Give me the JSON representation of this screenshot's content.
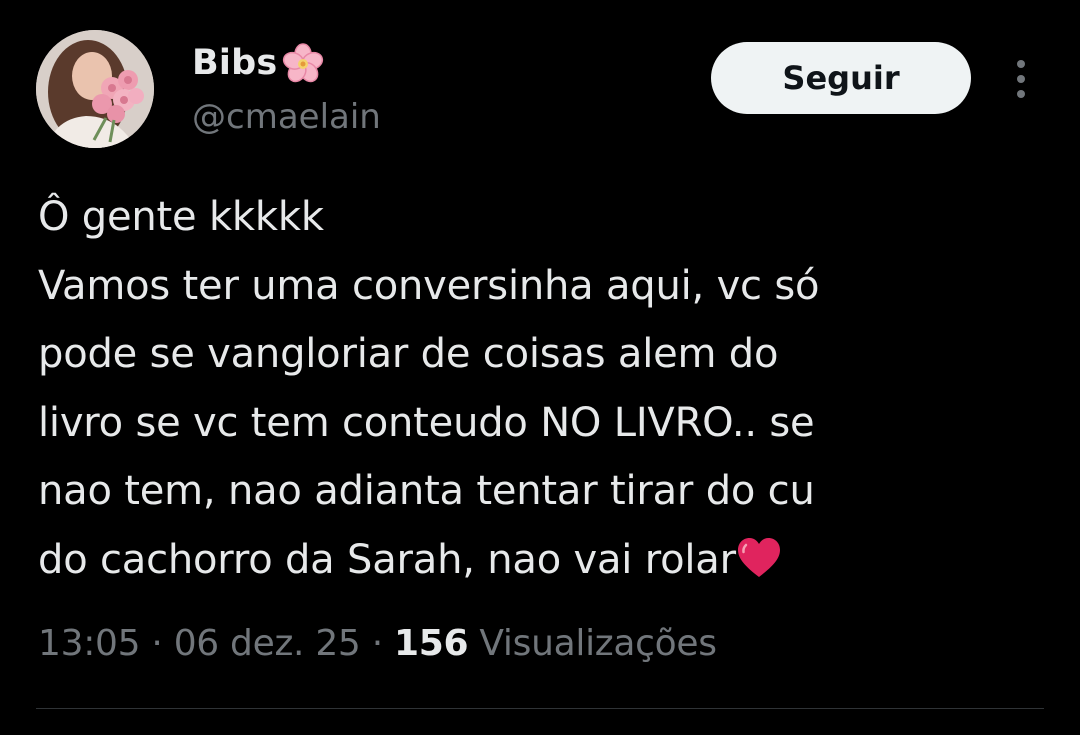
{
  "user": {
    "display_name": "Bibs",
    "name_emoji_icon": "cherry-blossom-icon",
    "handle": "@cmaelain"
  },
  "header": {
    "follow_label": "Seguir",
    "more_icon": "more-vertical-icon"
  },
  "tweet": {
    "lines": [
      "Ô gente kkkkk",
      "Vamos ter uma conversinha aqui, vc só",
      "pode se vangloriar de coisas alem do",
      "livro se vc tem conteudo NO LIVRO.. se",
      "nao tem, nao adianta tentar tirar do cu",
      "do cachorro da Sarah, nao vai rolar"
    ],
    "trailing_emoji_icon": "red-heart-icon"
  },
  "meta": {
    "time": "13:05",
    "separator": " · ",
    "date": "06 dez. 25",
    "views_count": "156",
    "views_label": "Visualizações"
  },
  "colors": {
    "background": "#000000",
    "primary_text": "#e7e9ea",
    "secondary_text": "#71767b",
    "button_bg": "#eff3f4",
    "button_text": "#0f1419",
    "divider": "#2f3336",
    "heart": "#e0245e"
  }
}
